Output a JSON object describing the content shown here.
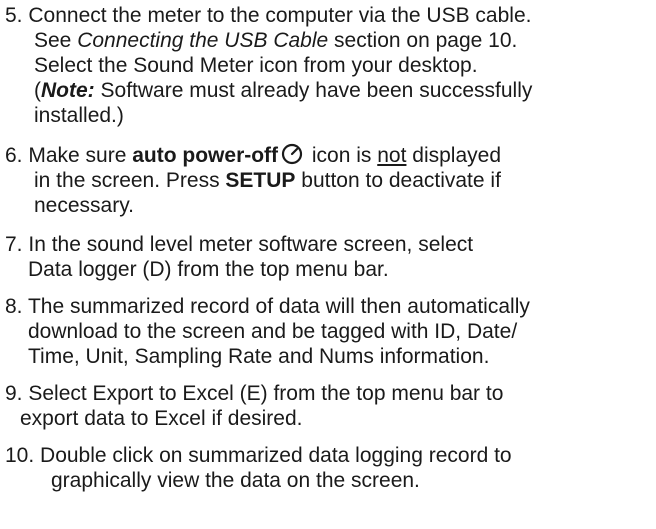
{
  "steps": [
    {
      "num": "5. ",
      "l1": "Connect the meter to the computer via the USB cable.",
      "l2a": "See ",
      "l2i": "Connecting the USB Cable",
      "l2b": " section on page 10.",
      "l3": "Select the Sound Meter icon from your desktop.",
      "l4a": "(",
      "l4note": "Note:",
      "l4b": " Software must already have been successfully",
      "l5": "installed.)"
    },
    {
      "num": "6. ",
      "l1a": "Make sure ",
      "l1b": "auto power-off",
      "l1c": " icon is ",
      "l1u": "not",
      "l1d": " displayed",
      "l2a": "in the screen. Press ",
      "l2b": "SETUP",
      "l2c": " button to deactivate if",
      "l3": "necessary."
    },
    {
      "num": "7. ",
      "l1": "In the sound level meter software screen, select",
      "l2": "Data logger (D) from the top menu bar."
    },
    {
      "num": "8. ",
      "l1": "The summarized record of data will then automatically",
      "l2": "download to the screen and be tagged with ID, Date/",
      "l3": "Time, Unit, Sampling Rate and Nums information."
    },
    {
      "num": "9. ",
      "l1": "Select Export to Excel (E) from the top menu bar to",
      "l2": "export data to Excel if desired."
    },
    {
      "num": "10. ",
      "l1": "Double click on summarized data logging record to",
      "l2": "graphically view the data on the screen."
    }
  ]
}
